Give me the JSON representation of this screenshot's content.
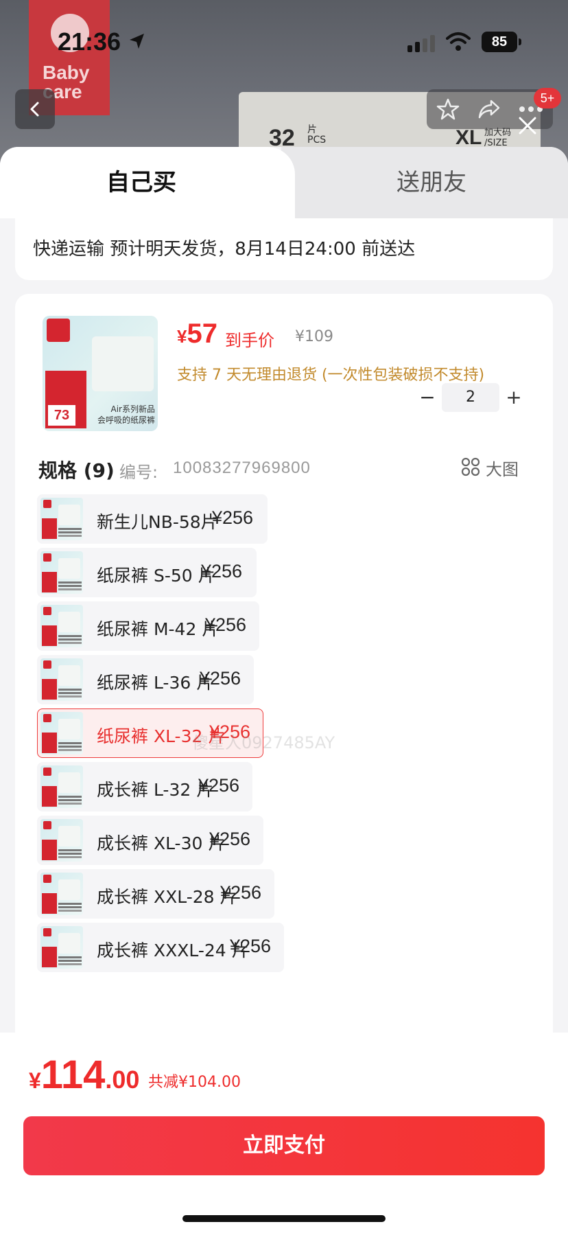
{
  "status_bar": {
    "time": "21:36",
    "battery": "85"
  },
  "background": {
    "brand_logo_text": [
      "Baby",
      "care"
    ],
    "pack_count": "32",
    "pack_unit": [
      "片",
      "PCS"
    ],
    "pack_size": "XL",
    "pack_size_label": [
      "加大码",
      "/SIZE"
    ],
    "badge": "5+"
  },
  "tabs": {
    "self": "自己买",
    "friend": "送朋友"
  },
  "delivery": {
    "text": "快递运输 预计明天发货，8月14日24:00 前送达"
  },
  "product": {
    "image_caption": [
      "Air系列新品",
      "会呼吸的纸尿裤"
    ],
    "image_badge": "73",
    "price_currency": "¥",
    "price_value": "57",
    "price_label": "到手价",
    "original_price": "¥109",
    "return_policy": "支持 7 天无理由退货 (一次性包装破损不支持)",
    "quantity": "2",
    "qty_minus": "−",
    "qty_plus": "+"
  },
  "spec": {
    "title": "规格 (9)",
    "code_label": "编号:",
    "code": "10083277969800",
    "big_picture_label": "大图",
    "items": [
      {
        "name": "新生儿NB-58片",
        "price": "¥256",
        "selected": false
      },
      {
        "name": "纸尿裤 S-50 片",
        "price": "¥256",
        "selected": false
      },
      {
        "name": "纸尿裤 M-42 片",
        "price": "¥256",
        "selected": false
      },
      {
        "name": "纸尿裤 L-36 片",
        "price": "¥256",
        "selected": false
      },
      {
        "name": "纸尿裤 XL-32 片",
        "price": "¥256",
        "selected": true
      },
      {
        "name": "成长裤 L-32 片",
        "price": "¥256",
        "selected": false
      },
      {
        "name": "成长裤 XL-30 片",
        "price": "¥256",
        "selected": false
      },
      {
        "name": "成长裤 XXL-28 片",
        "price": "¥256",
        "selected": false
      },
      {
        "name": "成长裤 XXXL-24 片",
        "price": "¥256",
        "selected": false
      }
    ]
  },
  "watermark": "傻星人0927485AY",
  "footer": {
    "currency": "¥",
    "total_int": "114",
    "total_dec": ".00",
    "discount": "共减¥104.00",
    "pay_button": "立即支付"
  },
  "colors": {
    "accent": "#ee2b2b",
    "policy": "#c28a2c",
    "selected_bg": "#fdeeee"
  }
}
